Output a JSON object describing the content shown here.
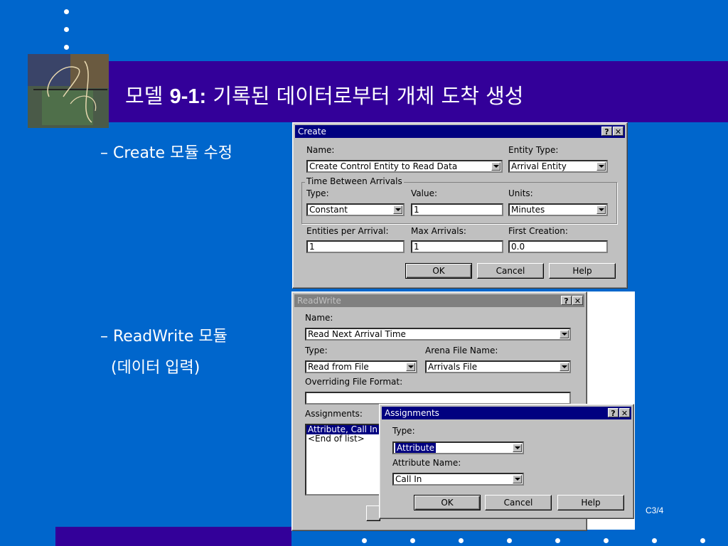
{
  "slide": {
    "title_prefix": "모델 ",
    "title_bold": "9-1:",
    "title_rest": " 기록된 데이터로부터 개체 도착 생성",
    "bullet1": "–  Create 모듈 수정",
    "bullet2_line1": "–  ReadWrite 모듈",
    "bullet2_line2": "(데이터 입력)",
    "page_number": "C3/4"
  },
  "colors": {
    "background": "#0066cc",
    "band": "#330099",
    "titlebar": "#000080"
  },
  "create_dialog": {
    "title": "Create",
    "help_btn": "?",
    "close_btn": "✕",
    "name_label": "Name:",
    "name_value": "Create Control Entity to Read Data",
    "entity_type_label": "Entity Type:",
    "entity_type_value": "Arrival Entity",
    "group_title": "Time Between Arrivals",
    "type_label": "Type:",
    "type_value": "Constant",
    "value_label": "Value:",
    "value_value": "1",
    "units_label": "Units:",
    "units_value": "Minutes",
    "entities_label": "Entities per Arrival:",
    "entities_value": "1",
    "max_label": "Max Arrivals:",
    "max_value": "1",
    "first_label": "First Creation:",
    "first_value": "0.0",
    "ok": "OK",
    "cancel": "Cancel",
    "help": "Help"
  },
  "readwrite_dialog": {
    "title": "ReadWrite",
    "help_btn": "?",
    "close_btn": "✕",
    "name_label": "Name:",
    "name_value": "Read Next Arrival Time",
    "type_label": "Type:",
    "type_value": "Read from File",
    "arena_label": "Arena File Name:",
    "arena_value": "Arrivals File",
    "format_label": "Overriding File Format:",
    "format_value": "",
    "assign_label": "Assignments:",
    "assign_items": [
      "Attribute, Call In",
      "<End of list>"
    ]
  },
  "assign_dialog": {
    "title": "Assignments",
    "help_btn": "?",
    "close_btn": "✕",
    "type_label": "Type:",
    "type_value": "Attribute",
    "attr_label": "Attribute Name:",
    "attr_value": "Call In",
    "ok": "OK",
    "cancel": "Cancel",
    "help": "Help"
  }
}
